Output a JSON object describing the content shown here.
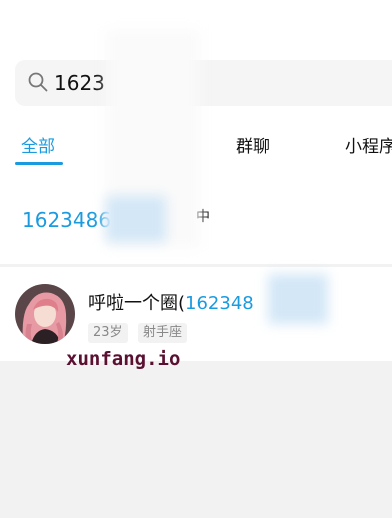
{
  "search": {
    "value": "1623"
  },
  "tabs": [
    {
      "label": "全部",
      "active": true
    },
    {
      "label": "群聊"
    },
    {
      "label": "小程序"
    }
  ],
  "results": [
    {
      "text": "1623486",
      "tail": "中"
    },
    {
      "name_prefix": "呼啦一个圈(",
      "name_highlight": "162348",
      "tags": [
        "23岁",
        "射手座"
      ]
    }
  ],
  "watermark": "xunfang.io",
  "colors": {
    "accent": "#1a9be0",
    "background": "#f2f2f2"
  }
}
